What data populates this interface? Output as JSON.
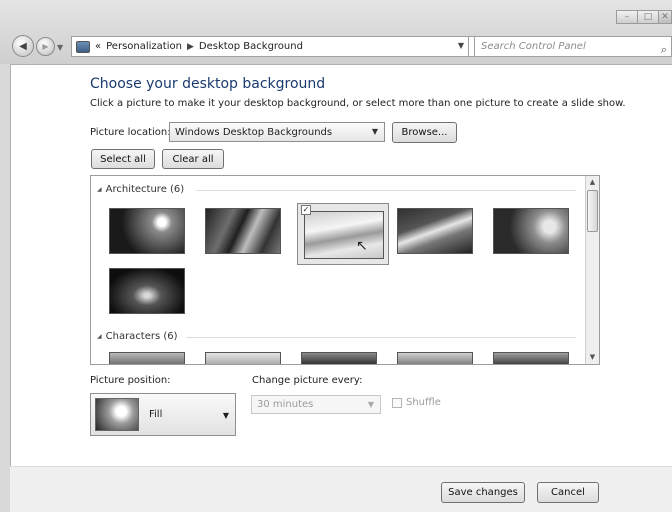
{
  "window": {
    "caption": {
      "minimize": "–",
      "maximize": "□",
      "close": "✕"
    }
  },
  "nav": {
    "overflow": "«",
    "breadcrumbs": [
      "Personalization",
      "Desktop Background"
    ],
    "search_placeholder": "Search Control Panel"
  },
  "page": {
    "heading": "Choose your desktop background",
    "subtext": "Click a picture to make it your desktop background, or select more than one picture to create a slide show."
  },
  "location": {
    "label": "Picture location:",
    "value": "Windows Desktop Backgrounds",
    "browse": "Browse..."
  },
  "selection": {
    "select_all": "Select all",
    "clear_all": "Clear all"
  },
  "groups": [
    {
      "label": "Architecture (6)"
    },
    {
      "label": "Characters (6)"
    }
  ],
  "options": {
    "position_label": "Picture position:",
    "position_value": "Fill",
    "change_label": "Change picture every:",
    "interval_value": "30 minutes",
    "shuffle_label": "Shuffle"
  },
  "footer": {
    "save": "Save changes",
    "cancel": "Cancel"
  },
  "colors": {
    "heading": "#1a3a6e",
    "disabled_text": "#9b9b9b"
  }
}
